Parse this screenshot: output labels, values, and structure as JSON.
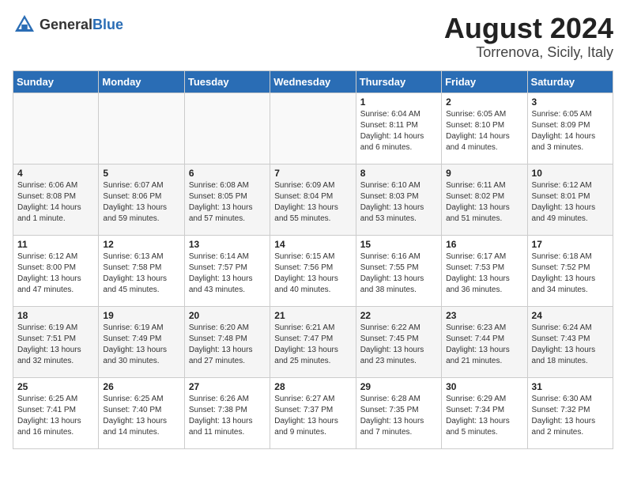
{
  "logo": {
    "general": "General",
    "blue": "Blue"
  },
  "title": "August 2024",
  "location": "Torrenova, Sicily, Italy",
  "weekdays": [
    "Sunday",
    "Monday",
    "Tuesday",
    "Wednesday",
    "Thursday",
    "Friday",
    "Saturday"
  ],
  "weeks": [
    [
      {
        "day": "",
        "sunrise": "",
        "sunset": "",
        "daylight": ""
      },
      {
        "day": "",
        "sunrise": "",
        "sunset": "",
        "daylight": ""
      },
      {
        "day": "",
        "sunrise": "",
        "sunset": "",
        "daylight": ""
      },
      {
        "day": "",
        "sunrise": "",
        "sunset": "",
        "daylight": ""
      },
      {
        "day": "1",
        "sunrise": "Sunrise: 6:04 AM",
        "sunset": "Sunset: 8:11 PM",
        "daylight": "Daylight: 14 hours and 6 minutes."
      },
      {
        "day": "2",
        "sunrise": "Sunrise: 6:05 AM",
        "sunset": "Sunset: 8:10 PM",
        "daylight": "Daylight: 14 hours and 4 minutes."
      },
      {
        "day": "3",
        "sunrise": "Sunrise: 6:05 AM",
        "sunset": "Sunset: 8:09 PM",
        "daylight": "Daylight: 14 hours and 3 minutes."
      }
    ],
    [
      {
        "day": "4",
        "sunrise": "Sunrise: 6:06 AM",
        "sunset": "Sunset: 8:08 PM",
        "daylight": "Daylight: 14 hours and 1 minute."
      },
      {
        "day": "5",
        "sunrise": "Sunrise: 6:07 AM",
        "sunset": "Sunset: 8:06 PM",
        "daylight": "Daylight: 13 hours and 59 minutes."
      },
      {
        "day": "6",
        "sunrise": "Sunrise: 6:08 AM",
        "sunset": "Sunset: 8:05 PM",
        "daylight": "Daylight: 13 hours and 57 minutes."
      },
      {
        "day": "7",
        "sunrise": "Sunrise: 6:09 AM",
        "sunset": "Sunset: 8:04 PM",
        "daylight": "Daylight: 13 hours and 55 minutes."
      },
      {
        "day": "8",
        "sunrise": "Sunrise: 6:10 AM",
        "sunset": "Sunset: 8:03 PM",
        "daylight": "Daylight: 13 hours and 53 minutes."
      },
      {
        "day": "9",
        "sunrise": "Sunrise: 6:11 AM",
        "sunset": "Sunset: 8:02 PM",
        "daylight": "Daylight: 13 hours and 51 minutes."
      },
      {
        "day": "10",
        "sunrise": "Sunrise: 6:12 AM",
        "sunset": "Sunset: 8:01 PM",
        "daylight": "Daylight: 13 hours and 49 minutes."
      }
    ],
    [
      {
        "day": "11",
        "sunrise": "Sunrise: 6:12 AM",
        "sunset": "Sunset: 8:00 PM",
        "daylight": "Daylight: 13 hours and 47 minutes."
      },
      {
        "day": "12",
        "sunrise": "Sunrise: 6:13 AM",
        "sunset": "Sunset: 7:58 PM",
        "daylight": "Daylight: 13 hours and 45 minutes."
      },
      {
        "day": "13",
        "sunrise": "Sunrise: 6:14 AM",
        "sunset": "Sunset: 7:57 PM",
        "daylight": "Daylight: 13 hours and 43 minutes."
      },
      {
        "day": "14",
        "sunrise": "Sunrise: 6:15 AM",
        "sunset": "Sunset: 7:56 PM",
        "daylight": "Daylight: 13 hours and 40 minutes."
      },
      {
        "day": "15",
        "sunrise": "Sunrise: 6:16 AM",
        "sunset": "Sunset: 7:55 PM",
        "daylight": "Daylight: 13 hours and 38 minutes."
      },
      {
        "day": "16",
        "sunrise": "Sunrise: 6:17 AM",
        "sunset": "Sunset: 7:53 PM",
        "daylight": "Daylight: 13 hours and 36 minutes."
      },
      {
        "day": "17",
        "sunrise": "Sunrise: 6:18 AM",
        "sunset": "Sunset: 7:52 PM",
        "daylight": "Daylight: 13 hours and 34 minutes."
      }
    ],
    [
      {
        "day": "18",
        "sunrise": "Sunrise: 6:19 AM",
        "sunset": "Sunset: 7:51 PM",
        "daylight": "Daylight: 13 hours and 32 minutes."
      },
      {
        "day": "19",
        "sunrise": "Sunrise: 6:19 AM",
        "sunset": "Sunset: 7:49 PM",
        "daylight": "Daylight: 13 hours and 30 minutes."
      },
      {
        "day": "20",
        "sunrise": "Sunrise: 6:20 AM",
        "sunset": "Sunset: 7:48 PM",
        "daylight": "Daylight: 13 hours and 27 minutes."
      },
      {
        "day": "21",
        "sunrise": "Sunrise: 6:21 AM",
        "sunset": "Sunset: 7:47 PM",
        "daylight": "Daylight: 13 hours and 25 minutes."
      },
      {
        "day": "22",
        "sunrise": "Sunrise: 6:22 AM",
        "sunset": "Sunset: 7:45 PM",
        "daylight": "Daylight: 13 hours and 23 minutes."
      },
      {
        "day": "23",
        "sunrise": "Sunrise: 6:23 AM",
        "sunset": "Sunset: 7:44 PM",
        "daylight": "Daylight: 13 hours and 21 minutes."
      },
      {
        "day": "24",
        "sunrise": "Sunrise: 6:24 AM",
        "sunset": "Sunset: 7:43 PM",
        "daylight": "Daylight: 13 hours and 18 minutes."
      }
    ],
    [
      {
        "day": "25",
        "sunrise": "Sunrise: 6:25 AM",
        "sunset": "Sunset: 7:41 PM",
        "daylight": "Daylight: 13 hours and 16 minutes."
      },
      {
        "day": "26",
        "sunrise": "Sunrise: 6:25 AM",
        "sunset": "Sunset: 7:40 PM",
        "daylight": "Daylight: 13 hours and 14 minutes."
      },
      {
        "day": "27",
        "sunrise": "Sunrise: 6:26 AM",
        "sunset": "Sunset: 7:38 PM",
        "daylight": "Daylight: 13 hours and 11 minutes."
      },
      {
        "day": "28",
        "sunrise": "Sunrise: 6:27 AM",
        "sunset": "Sunset: 7:37 PM",
        "daylight": "Daylight: 13 hours and 9 minutes."
      },
      {
        "day": "29",
        "sunrise": "Sunrise: 6:28 AM",
        "sunset": "Sunset: 7:35 PM",
        "daylight": "Daylight: 13 hours and 7 minutes."
      },
      {
        "day": "30",
        "sunrise": "Sunrise: 6:29 AM",
        "sunset": "Sunset: 7:34 PM",
        "daylight": "Daylight: 13 hours and 5 minutes."
      },
      {
        "day": "31",
        "sunrise": "Sunrise: 6:30 AM",
        "sunset": "Sunset: 7:32 PM",
        "daylight": "Daylight: 13 hours and 2 minutes."
      }
    ]
  ]
}
